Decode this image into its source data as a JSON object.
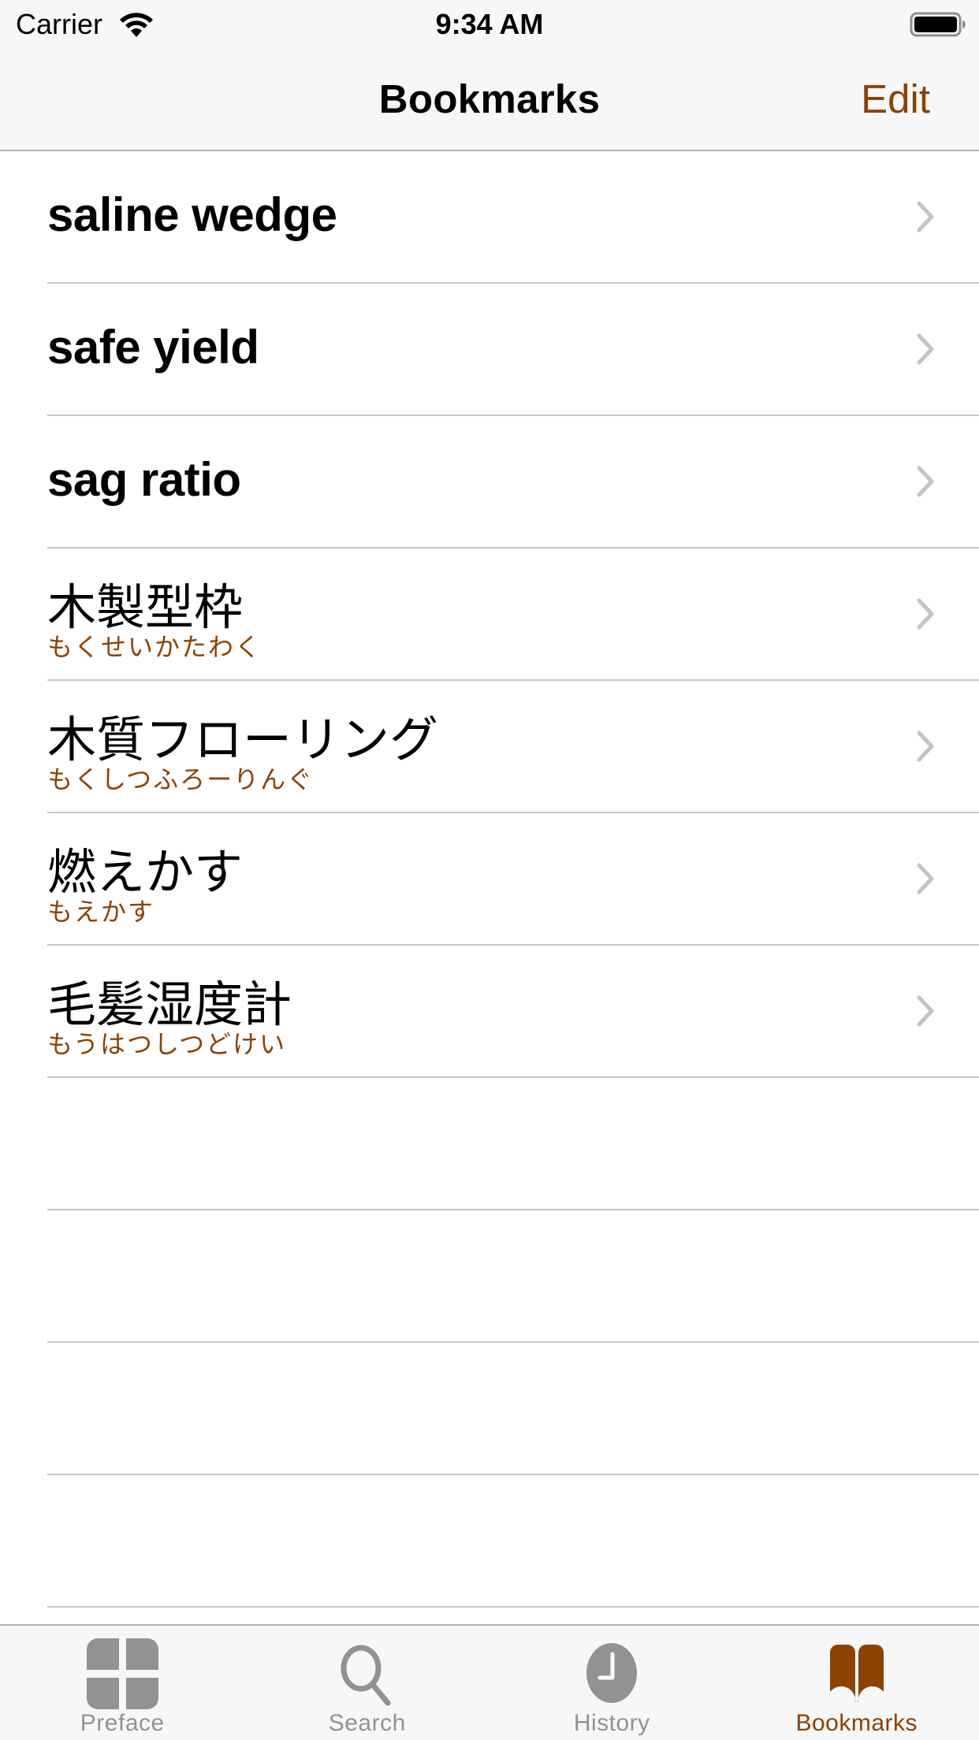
{
  "status_bar": {
    "carrier": "Carrier",
    "time": "9:34 AM",
    "wifi_icon": "wifi-icon",
    "battery_icon": "battery-full-icon"
  },
  "nav": {
    "title": "Bookmarks",
    "edit_label": "Edit"
  },
  "colors": {
    "accent": "#8b4203",
    "inactive_tab": "#929292",
    "separator": "#c8c7cc",
    "bar_background": "#f7f7f7"
  },
  "bookmarks": [
    {
      "term": "saline wedge",
      "reading": ""
    },
    {
      "term": "safe yield",
      "reading": ""
    },
    {
      "term": "sag ratio",
      "reading": ""
    },
    {
      "term": "木製型枠",
      "reading": "もくせいかたわく"
    },
    {
      "term": "木質フローリング",
      "reading": "もくしつふろーりんぐ"
    },
    {
      "term": "燃えかす",
      "reading": "もえかす"
    },
    {
      "term": "毛髪湿度計",
      "reading": "もうはつしつどけい"
    }
  ],
  "tabs": [
    {
      "label": "Preface",
      "icon": "preface-grid-icon",
      "active": false
    },
    {
      "label": "Search",
      "icon": "search-icon",
      "active": false
    },
    {
      "label": "History",
      "icon": "clock-icon",
      "active": false
    },
    {
      "label": "Bookmarks",
      "icon": "book-icon",
      "active": true
    }
  ]
}
